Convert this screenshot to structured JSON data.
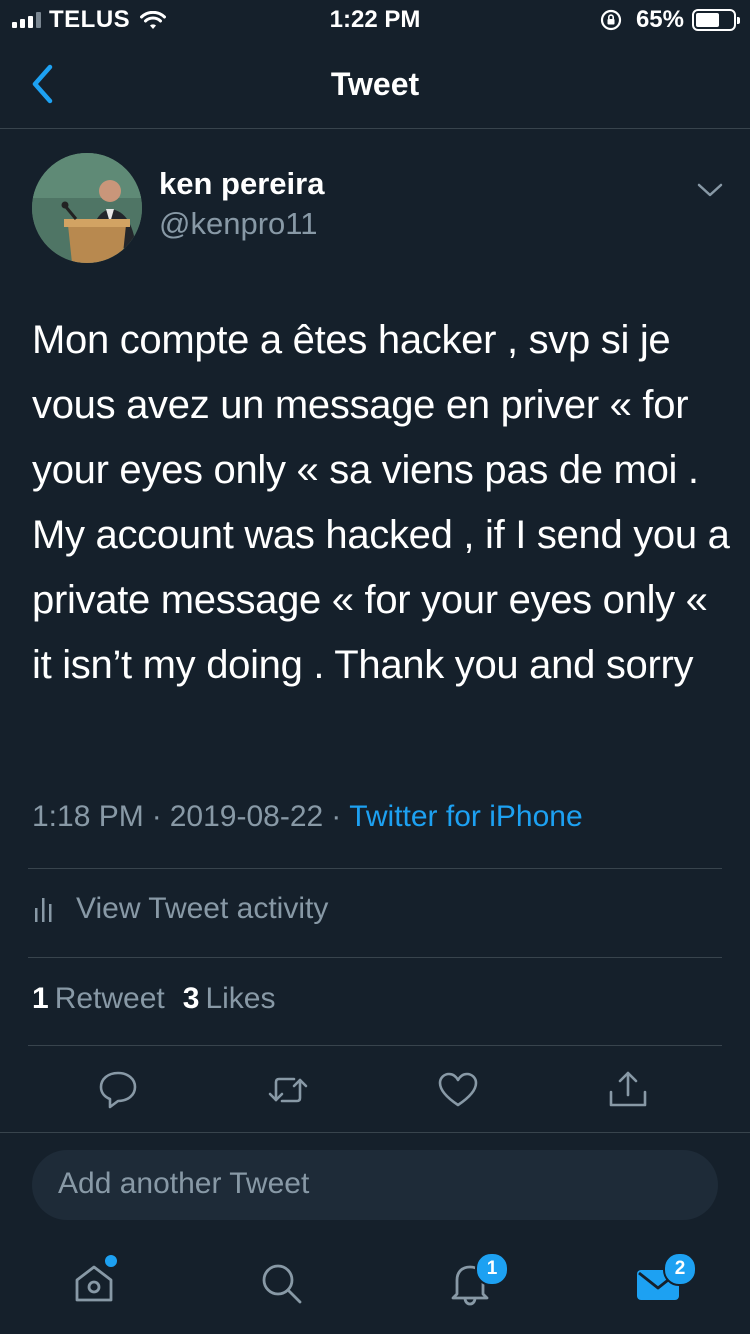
{
  "status_bar": {
    "carrier": "TELUS",
    "time": "1:22 PM",
    "battery_percent_label": "65%",
    "battery_level": 0.65
  },
  "nav": {
    "title": "Tweet"
  },
  "tweet": {
    "author_name": "ken pereira",
    "author_handle": "@kenpro11",
    "text": "Mon compte a êtes hacker , svp si je vous avez un message en priver « for your eyes only «  sa viens pas de moi . My account was hacked , if I send you a private message « for your eyes only «  it isn’t my doing . Thank you and sorry",
    "time": "1:18 PM",
    "separator": "·",
    "date": "2019-08-22",
    "source": "Twitter for iPhone",
    "activity_label": "View Tweet activity",
    "retweet_count": "1",
    "retweet_label": "Retweet",
    "like_count": "3",
    "like_label": "Likes"
  },
  "reply": {
    "placeholder": "Add another Tweet"
  },
  "tab_bar": {
    "notifications_badge": "1",
    "messages_badge": "2"
  },
  "colors": {
    "background": "#15202b",
    "accent": "#1da1f2",
    "secondary_text": "#8899a6",
    "divider": "#38444d"
  },
  "icons": {
    "back": "chevron-left-icon",
    "more": "chevron-down-icon",
    "activity": "bar-chart-icon",
    "reply": "speech-bubble-icon",
    "retweet": "retweet-icon",
    "like": "heart-icon",
    "share": "share-icon",
    "home": "home-icon",
    "search": "search-icon",
    "notifications": "bell-icon",
    "messages": "envelope-icon"
  }
}
